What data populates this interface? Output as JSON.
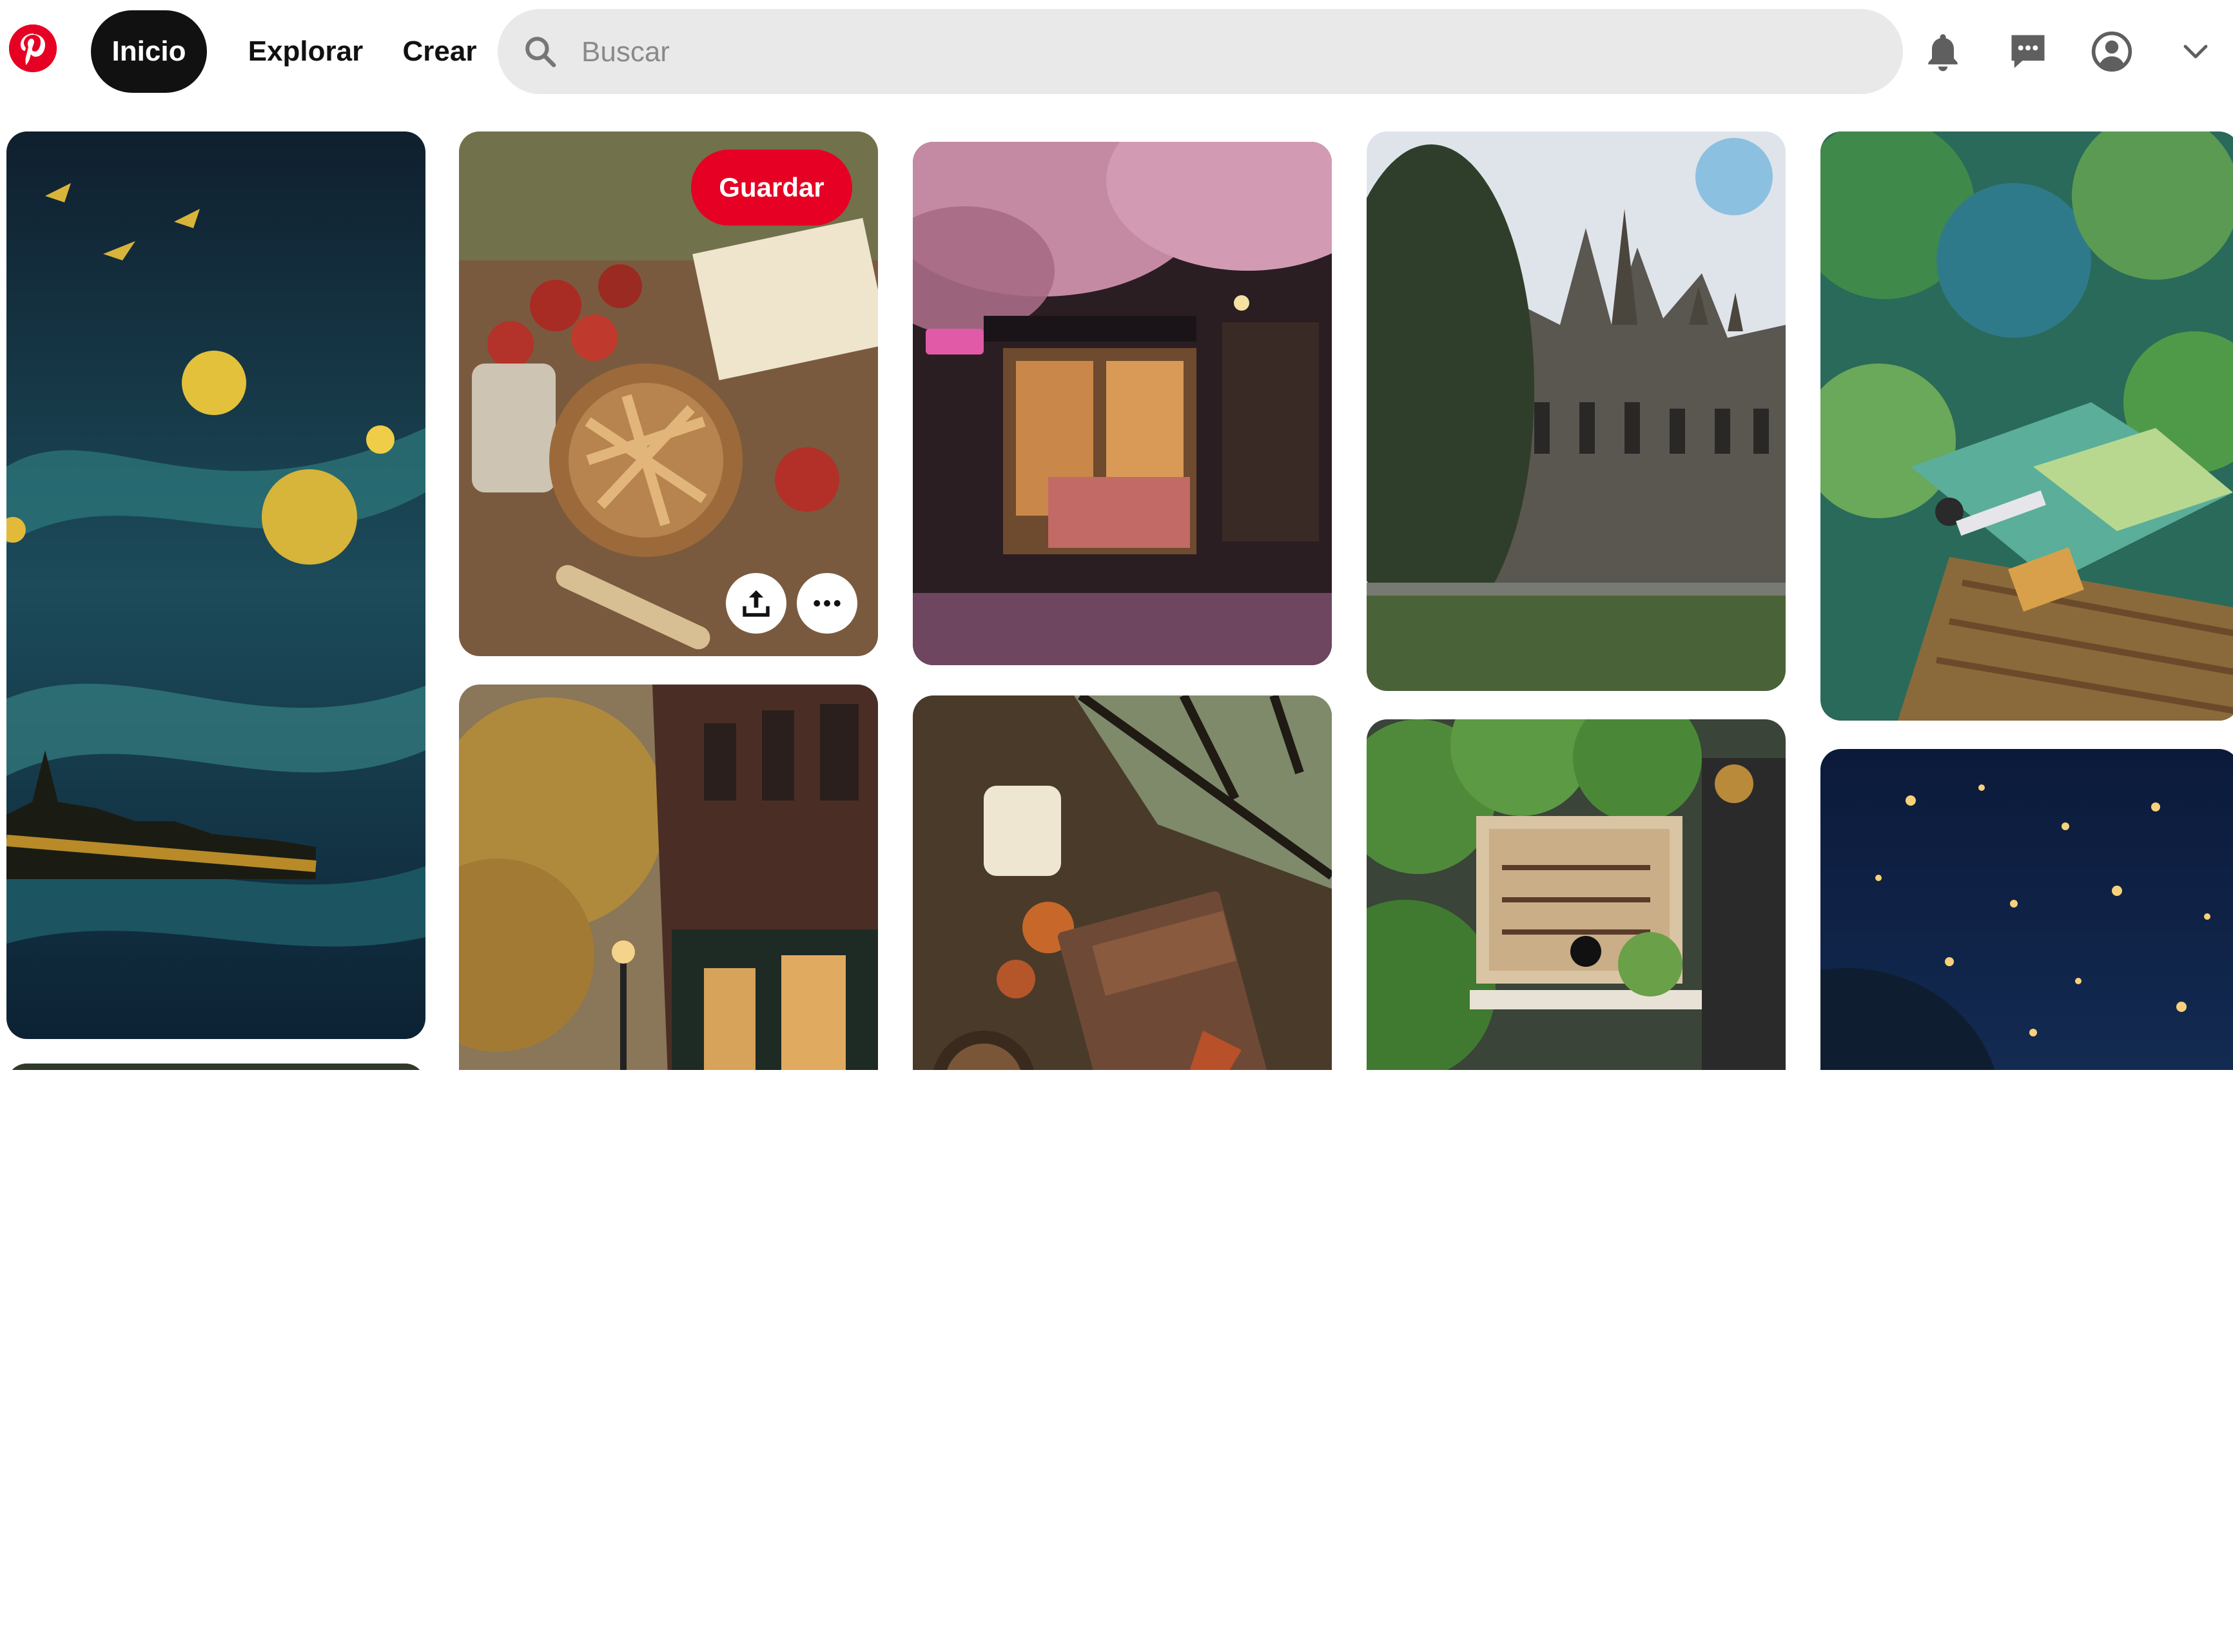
{
  "header": {
    "logo_icon": "pinterest-logo-icon",
    "nav": {
      "home": "Inicio",
      "explore": "Explorar",
      "create": "Crear"
    },
    "search": {
      "placeholder": "Buscar",
      "value": ""
    },
    "icons": [
      "bell-icon",
      "messages-icon",
      "profile-icon",
      "chevron-down-icon"
    ]
  },
  "feed": {
    "hovered_pin": {
      "save_label": "Guardar",
      "actions": [
        "share-icon",
        "more-options-icon"
      ]
    },
    "pins": [
      {
        "name": "starry-night-castle",
        "column": 1
      },
      {
        "name": "apple-pie-autumn",
        "column": 2
      },
      {
        "name": "autumn-street-bookstore",
        "column": 2
      },
      {
        "name": "bookshop-cherry-blossom",
        "column": 3
      },
      {
        "name": "harry-potter-book-cozy",
        "column": 3
      },
      {
        "name": "gothic-university-building",
        "column": 4
      },
      {
        "name": "ivy-shop-sign",
        "column": 4
      },
      {
        "name": "anime-girl-lying-on-blanket",
        "column": 5
      },
      {
        "name": "starry-sky-fireflies",
        "column": 5
      }
    ]
  },
  "colors": {
    "brand": "#e60023",
    "search_bg": "#e9e9e9",
    "active_nav": "#111111"
  }
}
